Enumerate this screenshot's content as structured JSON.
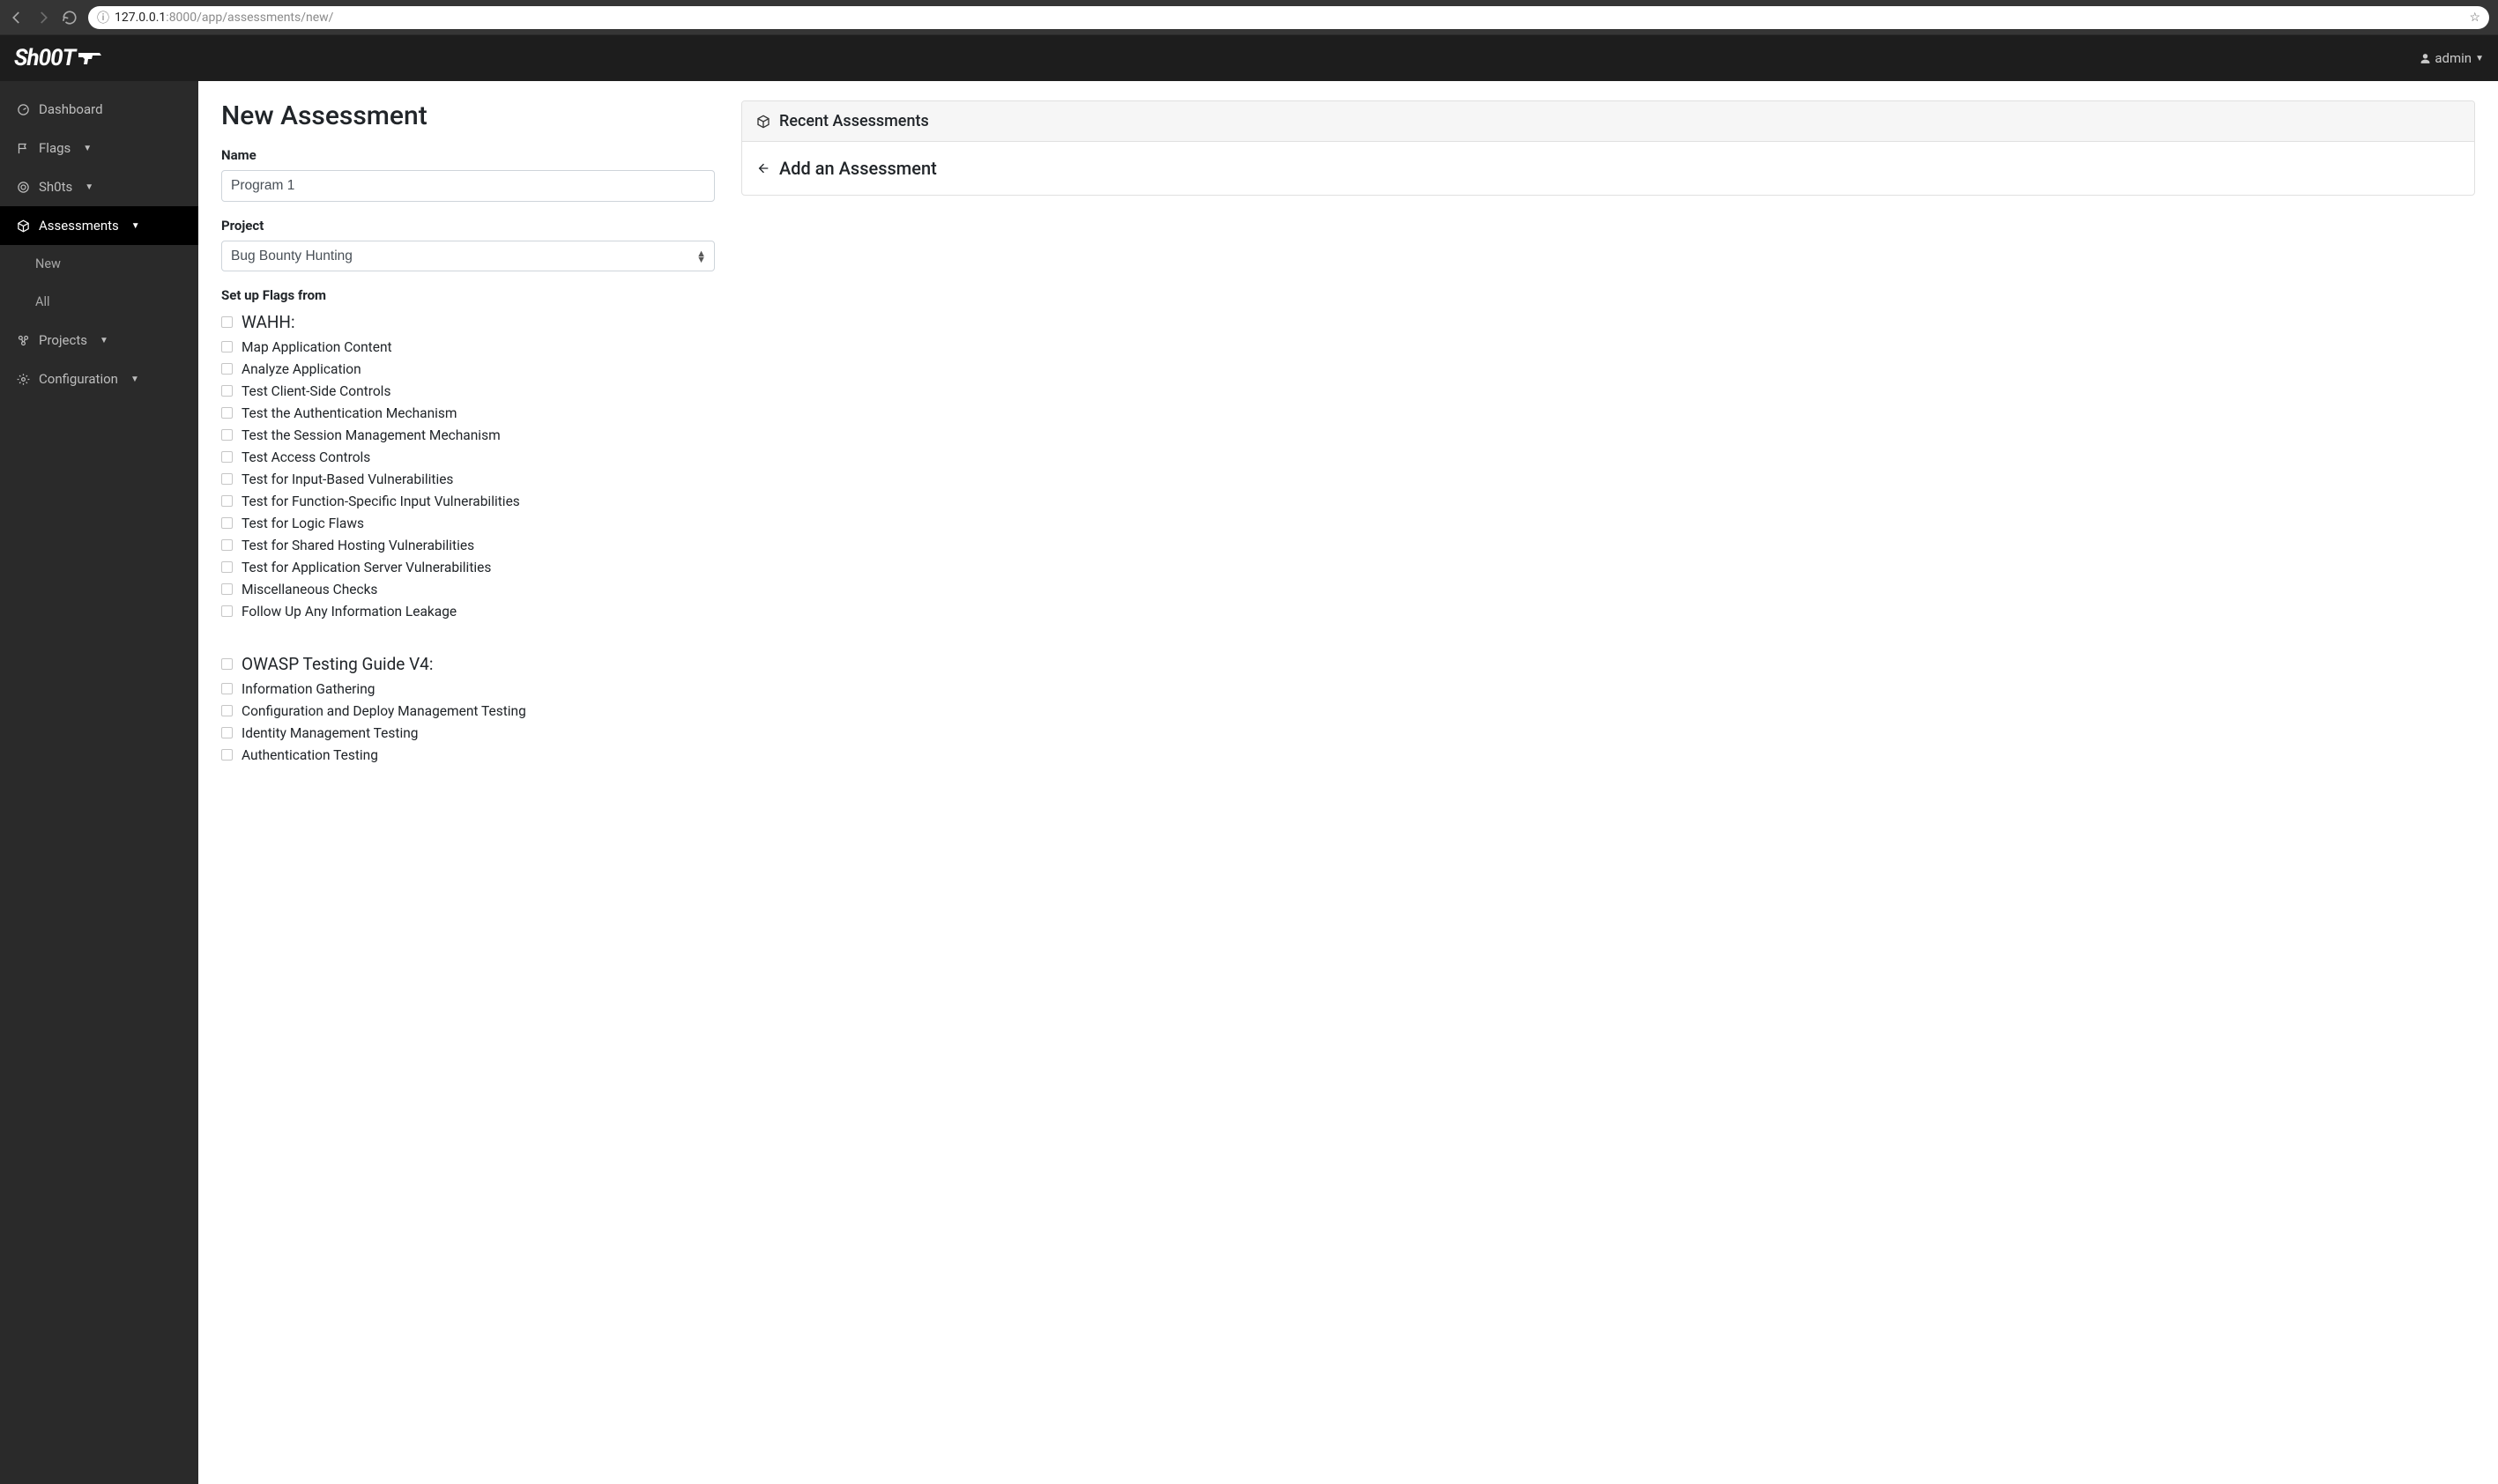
{
  "browser": {
    "url_host": "127.0.0.1",
    "url_path": ":8000/app/assessments/new/"
  },
  "brand": "Sh00T",
  "user": {
    "name": "admin"
  },
  "sidebar": {
    "items": [
      {
        "icon": "dashboard-icon",
        "label": "Dashboard",
        "expandable": false,
        "active": false
      },
      {
        "icon": "flag-icon",
        "label": "Flags",
        "expandable": true,
        "active": false
      },
      {
        "icon": "target-icon",
        "label": "Sh0ts",
        "expandable": true,
        "active": false
      },
      {
        "icon": "cube-icon",
        "label": "Assessments",
        "expandable": true,
        "active": true,
        "children": [
          {
            "label": "New"
          },
          {
            "label": "All"
          }
        ]
      },
      {
        "icon": "project-icon",
        "label": "Projects",
        "expandable": true,
        "active": false
      },
      {
        "icon": "gear-icon",
        "label": "Configuration",
        "expandable": true,
        "active": false
      }
    ]
  },
  "page": {
    "title": "New Assessment"
  },
  "form": {
    "name_label": "Name",
    "name_value": "Program 1",
    "project_label": "Project",
    "project_value": "Bug Bounty Hunting",
    "flags_label": "Set up Flags from"
  },
  "flag_groups": [
    {
      "title": "WAHH:",
      "items": [
        "Map Application Content",
        "Analyze Application",
        "Test Client-Side Controls",
        "Test the Authentication Mechanism",
        "Test the Session Management Mechanism",
        "Test Access Controls",
        "Test for Input-Based Vulnerabilities",
        "Test for Function-Specific Input Vulnerabilities",
        "Test for Logic Flaws",
        "Test for Shared Hosting Vulnerabilities",
        "Test for Application Server Vulnerabilities",
        "Miscellaneous Checks",
        "Follow Up Any Information Leakage"
      ]
    },
    {
      "title": "OWASP Testing Guide V4:",
      "items": [
        "Information Gathering",
        "Configuration and Deploy Management Testing",
        "Identity Management Testing",
        "Authentication Testing"
      ]
    }
  ],
  "side_card": {
    "header": "Recent Assessments",
    "back_link": "Add an Assessment"
  }
}
